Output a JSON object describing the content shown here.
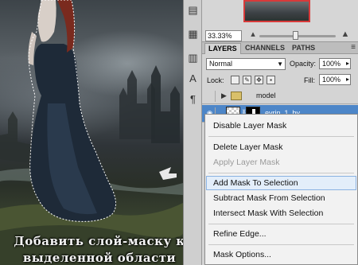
{
  "navigator": {
    "zoom": "33.33%"
  },
  "layers_panel": {
    "tabs": [
      {
        "label": "LAYERS",
        "active": true
      },
      {
        "label": "CHANNELS",
        "active": false
      },
      {
        "label": "PATHS",
        "active": false
      }
    ],
    "blend_mode": "Normal",
    "opacity_label": "Opacity:",
    "opacity_value": "100%",
    "lock_label": "Lock:",
    "fill_label": "Fill:",
    "fill_value": "100%",
    "group_layer": {
      "name": "model"
    },
    "selected_layer": {
      "name": "evrin_1_by_..."
    }
  },
  "context_menu": {
    "items": [
      {
        "label": "Disable Layer Mask",
        "enabled": true
      },
      {
        "label": "Delete Layer Mask",
        "enabled": true
      },
      {
        "label": "Apply Layer Mask",
        "enabled": false
      },
      {
        "label": "Add Mask To Selection",
        "enabled": true,
        "highlighted": true
      },
      {
        "label": "Subtract Mask From Selection",
        "enabled": true
      },
      {
        "label": "Intersect Mask With Selection",
        "enabled": true
      },
      {
        "label": "Refine Edge...",
        "enabled": true
      },
      {
        "label": "Mask Options...",
        "enabled": true
      }
    ]
  },
  "caption": {
    "line1": "Добавить слой-маску к",
    "line2": "выделенной области"
  },
  "colors": {
    "selection_blue": "#4d86c8",
    "menu_highlight": "#e3eefa",
    "navigator_frame": "#d83a3a"
  }
}
